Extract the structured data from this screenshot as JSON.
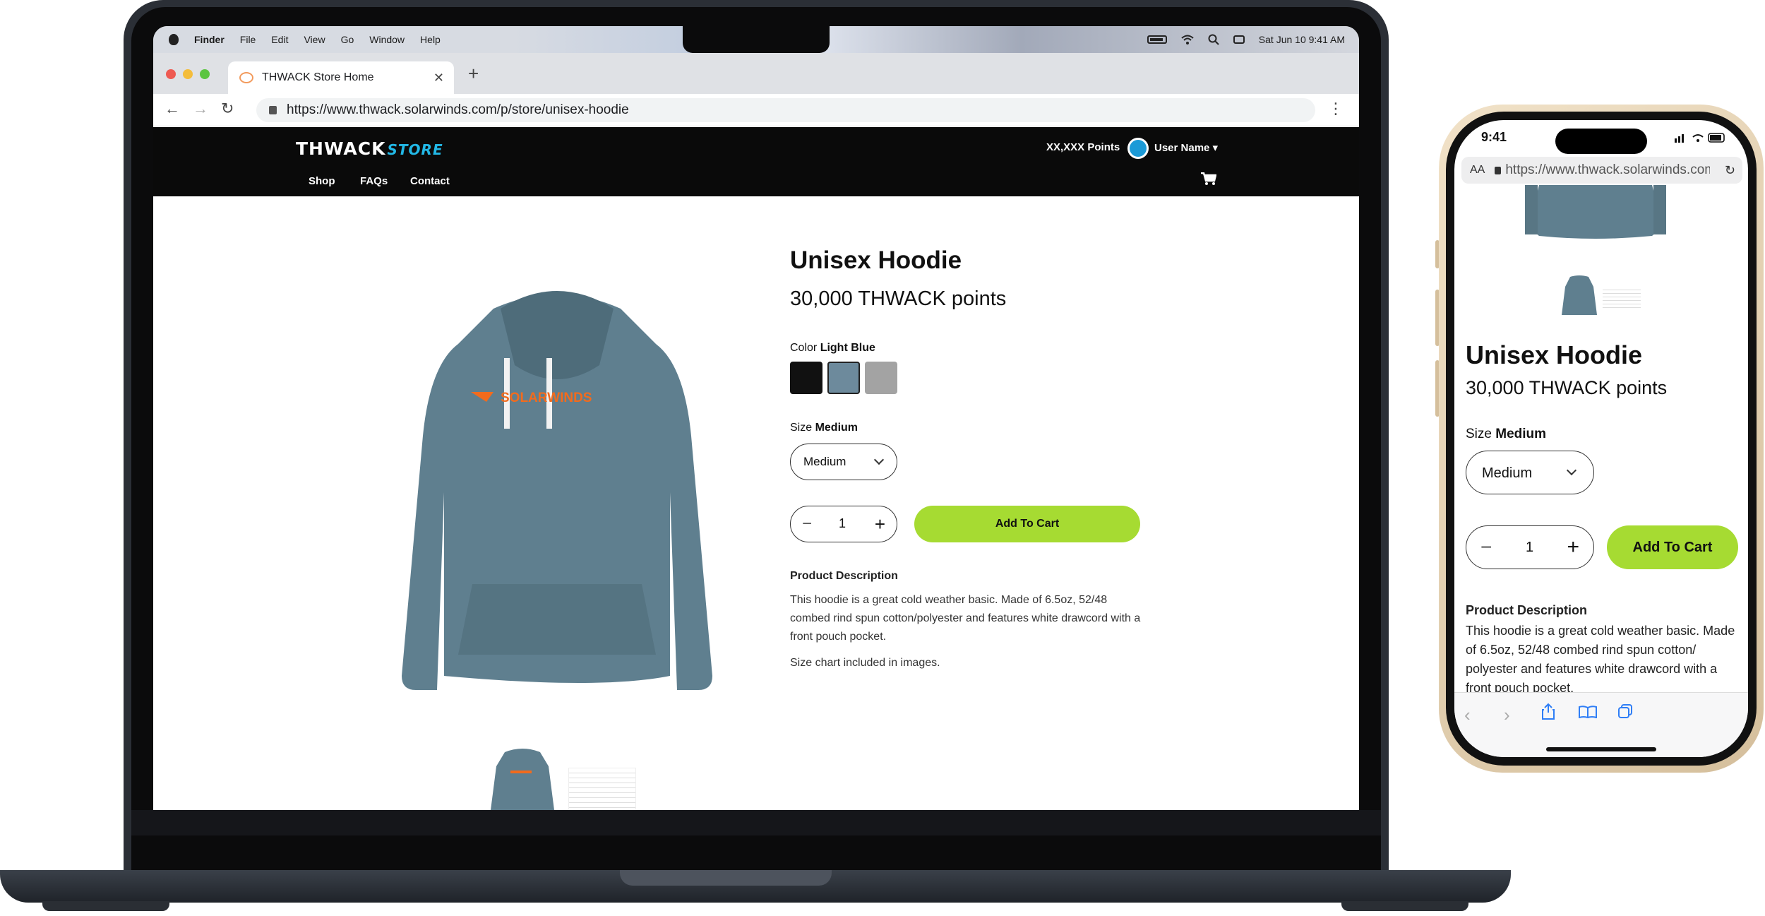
{
  "mac_menubar": {
    "app": "Finder",
    "menus": [
      "File",
      "Edit",
      "View",
      "Go",
      "Window",
      "Help"
    ],
    "clock": "Sat Jun 10  9:41 AM"
  },
  "browser": {
    "tab_title": "THWACK Store Home",
    "url": "https://www.thwack.solarwinds.com/p/store/unisex-hoodie"
  },
  "site": {
    "logo_main": "THWACK",
    "logo_sub": "STORE",
    "points": "XX,XXX Points",
    "user_name": "User Name",
    "nav": [
      "Shop",
      "FAQs",
      "Contact"
    ]
  },
  "product": {
    "title": "Unisex Hoodie",
    "price": "30,000 THWACK points",
    "color_label": "Color",
    "color_value": "Light Blue",
    "swatches": [
      "#111111",
      "#6d8a9c",
      "#a3a3a3"
    ],
    "size_label": "Size",
    "size_value": "Medium",
    "quantity": "1",
    "add_to_cart": "Add To Cart",
    "desc_heading": "Product Description",
    "desc_body": "This hoodie is a great cold weather basic. Made of 6.5oz, 52/48 combed rind spun cotton/polyester and features white drawcord with a front pouch pocket.",
    "desc_note": "Size chart included in images.",
    "logo_text": "SOLARWINDS"
  },
  "phone": {
    "time": "9:41",
    "aa": "AA",
    "url": "https://www.thwack.solarwinds.com/p/store/unisex-hoodie",
    "title": "Unisex Hoodie",
    "price": "30,000 THWACK points",
    "size_label": "Size",
    "size_value": "Medium",
    "quantity": "1",
    "add_to_cart": "Add To Cart",
    "desc_heading": "Product Description",
    "desc_body": "This hoodie is a great cold weather basic. Made of 6.5oz, 52/48 combed rind spun cotton/ polyester and features white drawcord with a front pouch pocket."
  },
  "colors": {
    "accent_green": "#a6db32",
    "header_black": "#0a0a0a",
    "hoodie": "#5f7f8f",
    "brand_orange": "#f26b1d"
  }
}
